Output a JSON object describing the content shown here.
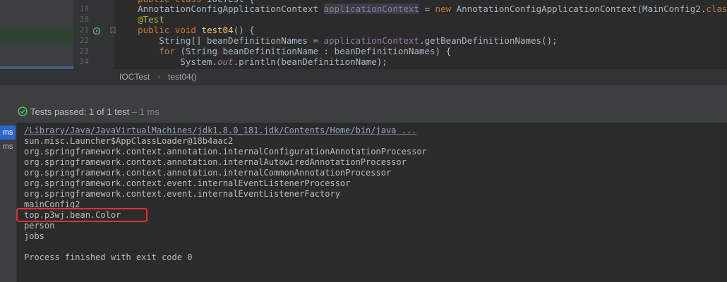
{
  "editor": {
    "lines": [
      {
        "num": "",
        "parts": [
          {
            "t": "    ",
            "c": ""
          },
          {
            "t": "public class",
            "c": "kw"
          },
          {
            "t": " IOCTest {",
            "c": ""
          }
        ]
      },
      {
        "num": "19",
        "parts": [
          {
            "t": "    AnnotationConfigApplicationContext ",
            "c": ""
          },
          {
            "t": "applicationContext",
            "c": "fldbg"
          },
          {
            "t": " = ",
            "c": ""
          },
          {
            "t": "new",
            "c": "kw"
          },
          {
            "t": " AnnotationConfigApplicationContext(MainConfig2.",
            "c": ""
          },
          {
            "t": "class",
            "c": "kw"
          },
          {
            "t": ");",
            "c": ""
          }
        ]
      },
      {
        "num": "20",
        "parts": [
          {
            "t": "    ",
            "c": ""
          },
          {
            "t": "@Test",
            "c": "ann"
          }
        ]
      },
      {
        "num": "21",
        "parts": [
          {
            "t": "    ",
            "c": ""
          },
          {
            "t": "public void",
            "c": "kw"
          },
          {
            "t": " ",
            "c": ""
          },
          {
            "t": "test04",
            "c": "fn"
          },
          {
            "t": "() {",
            "c": ""
          }
        ]
      },
      {
        "num": "22",
        "parts": [
          {
            "t": "        String[] beanDefinitionNames = ",
            "c": ""
          },
          {
            "t": "applicationContext",
            "c": "fld"
          },
          {
            "t": ".getBeanDefinitionNames();",
            "c": ""
          }
        ]
      },
      {
        "num": "23",
        "parts": [
          {
            "t": "        ",
            "c": ""
          },
          {
            "t": "for",
            "c": "kw"
          },
          {
            "t": " (String beanDefinitionName : beanDefinitionNames) {",
            "c": ""
          }
        ]
      },
      {
        "num": "24",
        "parts": [
          {
            "t": "            System.",
            "c": ""
          },
          {
            "t": "out",
            "c": "st"
          },
          {
            "t": ".println(beanDefinitionName);",
            "c": ""
          }
        ]
      }
    ]
  },
  "breadcrumb": {
    "class_name": "IOCTest",
    "separator": "›",
    "method_name": "test04()"
  },
  "status": {
    "icon": "check-circle-icon",
    "passed_label": "Tests passed: ",
    "passed_count": "1",
    "of_label": " of 1 test",
    "duration": " – 1 ms"
  },
  "tree": {
    "items": [
      "ms",
      "ms"
    ]
  },
  "console": {
    "command": "/Library/Java/JavaVirtualMachines/jdk1.8.0_181.jdk/Contents/Home/bin/java ...",
    "lines": [
      "sun.misc.Launcher$AppClassLoader@18b4aac2",
      "org.springframework.context.annotation.internalConfigurationAnnotationProcessor",
      "org.springframework.context.annotation.internalAutowiredAnnotationProcessor",
      "org.springframework.context.annotation.internalCommonAnnotationProcessor",
      "org.springframework.context.event.internalEventListenerProcessor",
      "org.springframework.context.event.internalEventListenerFactory",
      "mainConfig2",
      "top.p3wj.bean.Color",
      "person",
      "jobs",
      "",
      "Process finished with exit code 0"
    ]
  },
  "colors": {
    "highlight_box": "#e0303a",
    "selected": "#2f65ca",
    "success": "#5fb85f"
  }
}
